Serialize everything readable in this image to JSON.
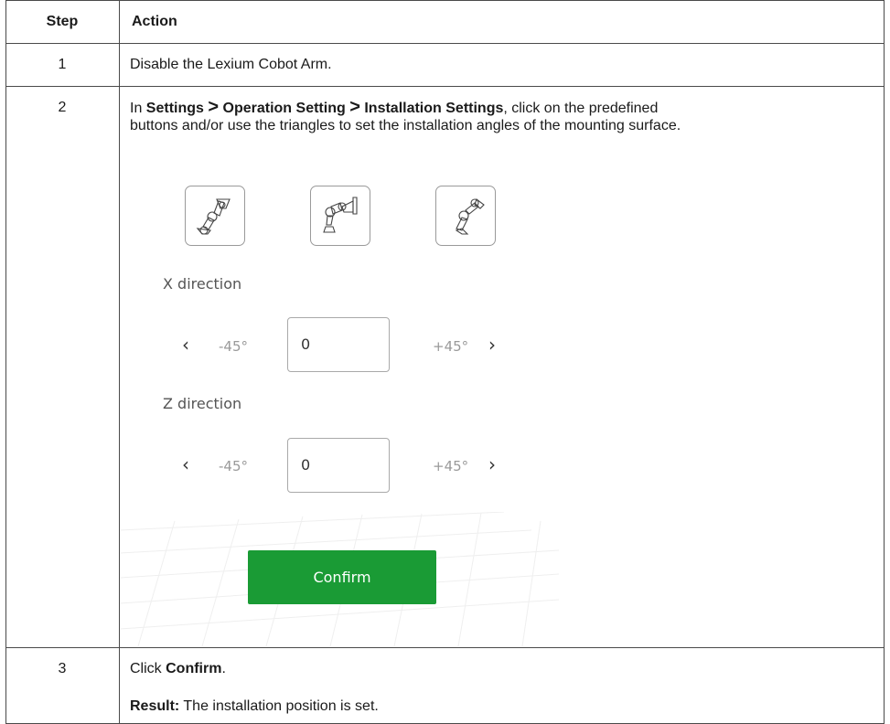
{
  "table": {
    "header": {
      "step": "Step",
      "action": "Action"
    },
    "rows": [
      {
        "step": "1",
        "text": "Disable the Lexium Cobot Arm."
      },
      {
        "step": "2",
        "line1_prefix": "In ",
        "path_settings": "Settings",
        "separator": ">",
        "path_operation": "Operation Setting",
        "path_installation": "Installation Settings",
        "line1_suffix": ", click on the predefined",
        "line2": "buttons and/or use the triangles to set the installation angles of the mounting surface."
      },
      {
        "step": "3",
        "click_prefix": "Click ",
        "click_bold": "Confirm",
        "click_suffix": ".",
        "result_label": "Result:",
        "result_text": " The installation position is set."
      }
    ]
  },
  "installation_ui": {
    "presets": [
      {
        "icon": "robot-arm-floor-icon"
      },
      {
        "icon": "robot-arm-wall-icon"
      },
      {
        "icon": "robot-arm-ceiling-icon"
      }
    ],
    "x_direction": {
      "label": "X direction",
      "min_label": "-45°",
      "value": "0",
      "max_label": "+45°",
      "prev_glyph": "‹",
      "next_glyph": "›"
    },
    "z_direction": {
      "label": "Z direction",
      "min_label": "-45°",
      "value": "0",
      "max_label": "+45°",
      "prev_glyph": "‹",
      "next_glyph": "›"
    },
    "confirm_label": "Confirm",
    "colors": {
      "confirm": "#1a9b35",
      "border": "#9a9a9a"
    }
  }
}
